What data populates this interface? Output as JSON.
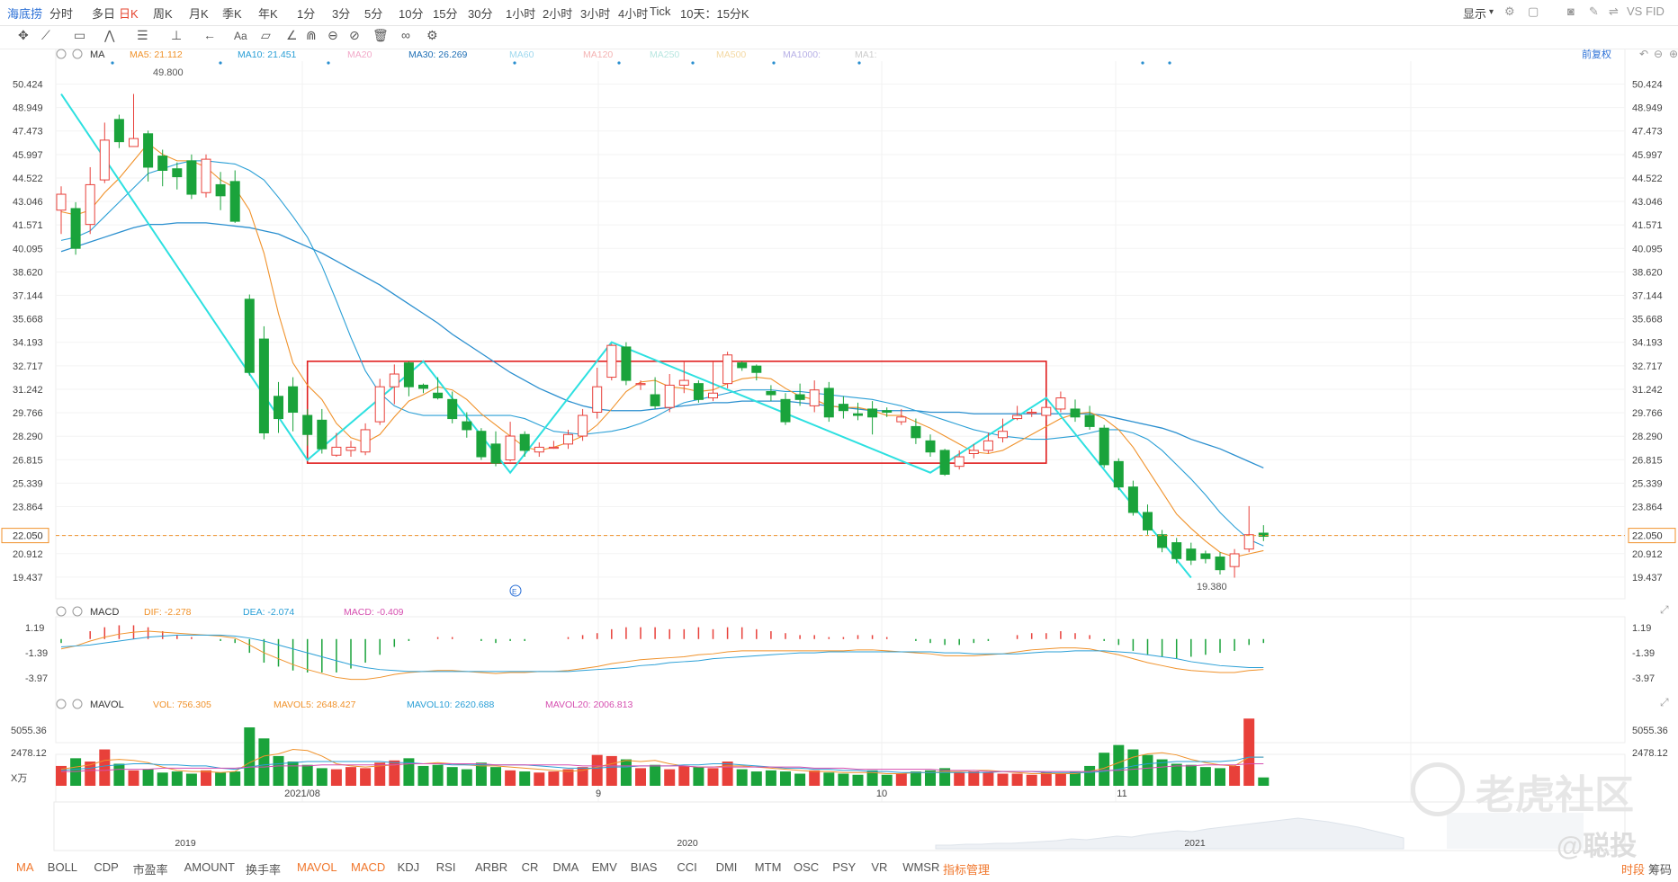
{
  "app": {
    "name": "海底捞"
  },
  "timeframes": [
    "分时",
    "多日",
    "日K",
    "周K",
    "月K",
    "季K",
    "年K",
    "1分",
    "3分",
    "5分",
    "10分",
    "15分",
    "30分",
    "1小时",
    "2小时",
    "3小时",
    "4小时",
    "Tick",
    "10天：15分K"
  ],
  "active_timeframe": "日K",
  "right_controls": {
    "display": "显示",
    "vs": "VS FID"
  },
  "price_legend": {
    "name": "MA",
    "items": [
      {
        "label": "MA5: 21.112",
        "color": "#f0922b"
      },
      {
        "label": "MA10: 21.451",
        "color": "#2a9fd6"
      },
      {
        "label": "MA20",
        "color": "#f2a9c9"
      },
      {
        "label": "MA30: 26.269",
        "color": "#1f6fb5"
      },
      {
        "label": "MA60",
        "color": "#9fd8ee"
      },
      {
        "label": "MA120",
        "color": "#f4b3b3"
      },
      {
        "label": "MA250",
        "color": "#b8e6e0"
      },
      {
        "label": "MA500",
        "color": "#f4d9a3"
      },
      {
        "label": "MA1000:",
        "color": "#b7b0e6"
      },
      {
        "label": "MA1:",
        "color": "#cccccc"
      }
    ],
    "adjust": "前复权"
  },
  "macd_legend": {
    "name": "MACD",
    "items": [
      {
        "label": "DIF: -2.278",
        "color": "#f0922b"
      },
      {
        "label": "DEA: -2.074",
        "color": "#2a9fd6"
      },
      {
        "label": "MACD: -0.409",
        "color": "#d64fb0"
      }
    ]
  },
  "vol_legend": {
    "name": "MAVOL",
    "items": [
      {
        "label": "VOL: 756.305",
        "color": "#f0922b"
      },
      {
        "label": "MAVOL5: 2648.427",
        "color": "#f0922b"
      },
      {
        "label": "MAVOL10: 2620.688",
        "color": "#2a9fd6"
      },
      {
        "label": "MAVOL20: 2006.813",
        "color": "#d64fb0"
      }
    ]
  },
  "annotations": {
    "high": "49.800",
    "low": "19.380",
    "current": "22.050",
    "event_marker": "E"
  },
  "x_labels": {
    "main": [
      "2021/08",
      "9",
      "10",
      "11"
    ],
    "overview": [
      "2019",
      "2020",
      "2021"
    ]
  },
  "indicators": [
    "MA",
    "BOLL",
    "CDP",
    "市盈率",
    "AMOUNT",
    "换手率",
    "MAVOL",
    "MACD",
    "KDJ",
    "RSI",
    "ARBR",
    "CR",
    "DMA",
    "EMV",
    "BIAS",
    "CCI",
    "DMI",
    "MTM",
    "OSC",
    "PSY",
    "VR",
    "WMSR"
  ],
  "active_indicators": [
    "MA",
    "MAVOL",
    "MACD"
  ],
  "indicator_manage": "指标管理",
  "right_tabs": [
    "时段",
    "筹码"
  ],
  "watermark": {
    "brand": "老虎社区",
    "user": "@聪投"
  },
  "chart_data": {
    "type": "candlestick",
    "y_ticks": [
      "50.424",
      "48.949",
      "47.473",
      "45.997",
      "44.522",
      "43.046",
      "41.571",
      "40.095",
      "38.620",
      "37.144",
      "35.668",
      "34.193",
      "32.717",
      "31.242",
      "29.766",
      "28.290",
      "26.815",
      "25.339",
      "23.864",
      "22.050",
      "20.912",
      "19.437"
    ],
    "ylim": [
      18.3,
      51.3
    ],
    "candles": [
      [
        42.5,
        43.5,
        41.0,
        44.0
      ],
      [
        42.6,
        40.1,
        39.7,
        43.0
      ],
      [
        41.6,
        44.1,
        41.0,
        45.2
      ],
      [
        44.4,
        46.9,
        44.2,
        48.0
      ],
      [
        48.2,
        46.8,
        46.4,
        48.5
      ],
      [
        46.5,
        47.0,
        46.5,
        49.8
      ],
      [
        47.3,
        45.2,
        44.3,
        47.5
      ],
      [
        45.9,
        45.0,
        44.0,
        46.3
      ],
      [
        45.1,
        44.6,
        43.8,
        45.5
      ],
      [
        45.6,
        43.5,
        43.2,
        46.0
      ],
      [
        43.6,
        45.7,
        43.3,
        46.0
      ],
      [
        44.1,
        43.4,
        42.5,
        44.9
      ],
      [
        44.3,
        41.8,
        41.7,
        45.0
      ],
      [
        36.9,
        32.3,
        32.1,
        37.2
      ],
      [
        34.4,
        28.5,
        28.1,
        35.2
      ],
      [
        30.8,
        29.4,
        28.5,
        31.7
      ],
      [
        31.4,
        29.8,
        28.6,
        32.0
      ],
      [
        29.6,
        28.4,
        27.7,
        30.0
      ],
      [
        29.3,
        27.5,
        27.2,
        30.0
      ],
      [
        27.1,
        27.6,
        27.0,
        28.5
      ],
      [
        27.4,
        27.6,
        27.0,
        28.0
      ],
      [
        27.3,
        28.7,
        27.1,
        29.1
      ],
      [
        29.2,
        31.4,
        29.0,
        31.9
      ],
      [
        31.4,
        32.2,
        30.3,
        32.8
      ],
      [
        32.9,
        31.4,
        30.8,
        33.0
      ],
      [
        31.5,
        31.3,
        31.0,
        31.6
      ],
      [
        31.0,
        30.7,
        30.6,
        32.0
      ],
      [
        30.6,
        29.4,
        29.1,
        31.1
      ],
      [
        29.2,
        28.7,
        28.2,
        29.8
      ],
      [
        28.6,
        27.0,
        26.8,
        28.8
      ],
      [
        27.8,
        26.6,
        26.4,
        28.6
      ],
      [
        26.8,
        28.3,
        26.7,
        29.2
      ],
      [
        28.4,
        27.4,
        27.0,
        28.6
      ],
      [
        27.3,
        27.6,
        27.0,
        27.9
      ],
      [
        27.6,
        27.6,
        27.5,
        28.0
      ],
      [
        27.8,
        28.4,
        27.5,
        28.7
      ],
      [
        28.3,
        29.6,
        28.0,
        30.0
      ],
      [
        29.8,
        31.4,
        29.4,
        32.6
      ],
      [
        32.0,
        34.0,
        31.8,
        34.1
      ],
      [
        33.9,
        31.8,
        31.5,
        34.2
      ],
      [
        31.6,
        31.6,
        31.2,
        31.8
      ],
      [
        30.9,
        30.2,
        30.0,
        32.0
      ],
      [
        30.1,
        31.5,
        29.8,
        32.2
      ],
      [
        31.5,
        31.8,
        31.0,
        33.0
      ],
      [
        31.6,
        30.6,
        30.4,
        31.8
      ],
      [
        30.7,
        31.0,
        30.5,
        33.0
      ],
      [
        31.6,
        33.4,
        31.3,
        33.6
      ],
      [
        32.9,
        32.6,
        32.4,
        33.0
      ],
      [
        32.7,
        32.3,
        31.8,
        32.8
      ],
      [
        31.1,
        30.9,
        30.5,
        31.5
      ],
      [
        30.6,
        29.2,
        29.0,
        31.0
      ],
      [
        30.9,
        30.6,
        30.2,
        31.6
      ],
      [
        30.2,
        31.2,
        29.8,
        31.8
      ],
      [
        31.3,
        29.5,
        29.2,
        31.7
      ],
      [
        30.3,
        29.9,
        29.4,
        30.8
      ],
      [
        29.7,
        29.6,
        29.3,
        30.4
      ],
      [
        30.0,
        29.5,
        28.4,
        30.5
      ],
      [
        29.9,
        29.8,
        29.5,
        30.1
      ],
      [
        29.2,
        29.5,
        29.0,
        30.0
      ],
      [
        28.9,
        28.2,
        27.8,
        29.4
      ],
      [
        28.0,
        27.3,
        27.0,
        28.4
      ],
      [
        27.4,
        25.9,
        25.8,
        27.5
      ],
      [
        26.4,
        27.0,
        26.2,
        27.4
      ],
      [
        27.2,
        27.4,
        26.9,
        27.8
      ],
      [
        27.4,
        28.0,
        27.2,
        28.5
      ],
      [
        28.2,
        28.6,
        27.9,
        29.4
      ],
      [
        29.4,
        29.6,
        29.3,
        30.2
      ],
      [
        29.8,
        29.8,
        29.5,
        30.0
      ],
      [
        29.6,
        30.1,
        29.3,
        30.3
      ],
      [
        30.0,
        30.7,
        29.8,
        31.1
      ],
      [
        30.0,
        29.5,
        29.2,
        30.6
      ],
      [
        29.6,
        28.9,
        28.7,
        30.2
      ],
      [
        28.8,
        26.5,
        26.3,
        29.0
      ],
      [
        26.7,
        25.1,
        24.9,
        26.9
      ],
      [
        25.1,
        23.5,
        23.3,
        25.5
      ],
      [
        23.5,
        22.4,
        22.1,
        24.0
      ],
      [
        22.1,
        21.3,
        21.0,
        22.4
      ],
      [
        21.6,
        20.6,
        20.3,
        21.9
      ],
      [
        21.2,
        20.5,
        20.2,
        21.6
      ],
      [
        20.9,
        20.6,
        20.3,
        21.1
      ],
      [
        20.7,
        19.9,
        19.6,
        21.0
      ],
      [
        20.1,
        20.9,
        19.4,
        21.2
      ],
      [
        21.2,
        22.1,
        21.0,
        23.9
      ],
      [
        22.2,
        22.0,
        21.7,
        22.7
      ]
    ],
    "ma5": [
      42.4,
      42.2,
      42.5,
      43.6,
      44.5,
      45.6,
      46.7,
      46.0,
      45.6,
      45.6,
      45.2,
      44.4,
      43.9,
      42.5,
      39.8,
      36.0,
      32.9,
      31.5,
      30.6,
      29.1,
      28.2,
      27.9,
      28.4,
      29.5,
      30.5,
      30.9,
      31.4,
      31.2,
      30.6,
      29.7,
      29.0,
      28.3,
      27.6,
      27.4,
      27.6,
      27.9,
      28.3,
      29.0,
      30.0,
      31.1,
      31.7,
      31.8,
      31.4,
      31.3,
      31.1,
      31.2,
      31.6,
      31.9,
      32.0,
      31.9,
      31.3,
      30.8,
      30.6,
      30.2,
      30.1,
      30.1,
      29.9,
      29.6,
      29.6,
      29.2,
      28.8,
      28.3,
      27.8,
      27.3,
      27.2,
      27.4,
      27.9,
      28.4,
      28.9,
      29.4,
      29.7,
      29.8,
      29.4,
      28.7,
      27.6,
      26.2,
      24.8,
      23.4,
      22.5,
      21.7,
      21.0,
      20.7,
      20.9,
      21.1
    ],
    "ma10": [
      40.6,
      40.8,
      41.2,
      42.1,
      43.0,
      43.9,
      44.8,
      45.1,
      45.4,
      45.6,
      45.6,
      45.5,
      45.4,
      45.0,
      44.4,
      43.3,
      42.1,
      40.8,
      39.0,
      36.8,
      34.5,
      32.4,
      31.0,
      30.2,
      29.8,
      29.6,
      29.6,
      29.6,
      29.6,
      29.6,
      29.6,
      29.6,
      29.4,
      29.0,
      28.6,
      28.5,
      28.4,
      28.5,
      28.6,
      28.8,
      29.1,
      29.5,
      30.0,
      30.4,
      30.6,
      30.8,
      31.0,
      31.2,
      31.2,
      31.2,
      31.1,
      31.1,
      31.0,
      30.9,
      30.8,
      30.7,
      30.6,
      30.4,
      30.2,
      29.9,
      29.6,
      29.3,
      29.0,
      28.7,
      28.5,
      28.3,
      28.2,
      28.1,
      28.1,
      28.2,
      28.3,
      28.5,
      28.7,
      28.7,
      28.5,
      28.1,
      27.4,
      26.5,
      25.6,
      24.6,
      23.5,
      22.6,
      21.8,
      21.4
    ],
    "ma30": [
      39.9,
      40.2,
      40.5,
      40.8,
      41.1,
      41.4,
      41.6,
      41.6,
      41.7,
      41.7,
      41.7,
      41.6,
      41.5,
      41.4,
      41.2,
      41.0,
      40.6,
      40.2,
      39.8,
      39.3,
      38.8,
      38.3,
      37.8,
      37.2,
      36.6,
      36.0,
      35.4,
      34.7,
      34.1,
      33.5,
      32.9,
      32.3,
      31.8,
      31.3,
      30.9,
      30.5,
      30.2,
      30.0,
      29.9,
      29.9,
      29.9,
      30.0,
      30.1,
      30.2,
      30.3,
      30.4,
      30.4,
      30.5,
      30.5,
      30.5,
      30.5,
      30.4,
      30.3,
      30.2,
      30.1,
      30.0,
      29.9,
      29.9,
      29.9,
      29.9,
      29.8,
      29.8,
      29.8,
      29.7,
      29.7,
      29.7,
      29.7,
      29.7,
      29.7,
      29.7,
      29.7,
      29.7,
      29.6,
      29.4,
      29.2,
      29.0,
      28.8,
      28.5,
      28.1,
      27.8,
      27.5,
      27.1,
      26.7,
      26.3
    ],
    "zigzag": [
      [
        0,
        49.8
      ],
      [
        17,
        26.8
      ],
      [
        25,
        33.0
      ],
      [
        31,
        26.0
      ],
      [
        38,
        34.2
      ],
      [
        60,
        26.0
      ],
      [
        68,
        30.7
      ],
      [
        78,
        19.4
      ]
    ],
    "box": {
      "x0": 17,
      "x1": 68,
      "y_top": 33.0,
      "y_bottom": 26.6
    },
    "current_price": 22.05,
    "macd_ticks": [
      "1.19",
      "-1.39",
      "-3.97"
    ],
    "macd_ylim": [
      -4.5,
      1.9
    ],
    "dif": [
      -1.0,
      -0.7,
      -0.2,
      0.2,
      0.5,
      0.7,
      0.8,
      0.7,
      0.6,
      0.5,
      0.4,
      0.3,
      0.1,
      -0.6,
      -1.4,
      -2.0,
      -2.6,
      -3.1,
      -3.5,
      -3.9,
      -4.1,
      -4.1,
      -3.9,
      -3.6,
      -3.4,
      -3.3,
      -3.2,
      -3.2,
      -3.3,
      -3.4,
      -3.5,
      -3.4,
      -3.4,
      -3.3,
      -3.3,
      -3.2,
      -3.0,
      -2.8,
      -2.5,
      -2.3,
      -2.1,
      -2.0,
      -1.9,
      -1.8,
      -1.6,
      -1.5,
      -1.3,
      -1.2,
      -1.2,
      -1.2,
      -1.2,
      -1.2,
      -1.2,
      -1.2,
      -1.2,
      -1.1,
      -1.1,
      -1.2,
      -1.3,
      -1.4,
      -1.5,
      -1.7,
      -1.7,
      -1.7,
      -1.6,
      -1.5,
      -1.3,
      -1.1,
      -1.0,
      -0.9,
      -0.9,
      -1.0,
      -1.3,
      -1.6,
      -2.0,
      -2.4,
      -2.7,
      -3.0,
      -3.2,
      -3.3,
      -3.4,
      -3.4,
      -3.2,
      -3.1
    ],
    "dea": [
      -0.8,
      -0.7,
      -0.6,
      -0.4,
      -0.2,
      0.0,
      0.2,
      0.3,
      0.4,
      0.4,
      0.4,
      0.4,
      0.3,
      0.1,
      -0.2,
      -0.6,
      -1.0,
      -1.4,
      -1.8,
      -2.2,
      -2.6,
      -2.9,
      -3.1,
      -3.2,
      -3.3,
      -3.3,
      -3.3,
      -3.3,
      -3.3,
      -3.3,
      -3.3,
      -3.3,
      -3.3,
      -3.3,
      -3.3,
      -3.3,
      -3.2,
      -3.1,
      -3.0,
      -2.9,
      -2.7,
      -2.6,
      -2.4,
      -2.3,
      -2.2,
      -2.0,
      -1.9,
      -1.8,
      -1.7,
      -1.6,
      -1.5,
      -1.4,
      -1.4,
      -1.3,
      -1.3,
      -1.3,
      -1.3,
      -1.3,
      -1.3,
      -1.3,
      -1.3,
      -1.4,
      -1.4,
      -1.5,
      -1.5,
      -1.5,
      -1.5,
      -1.4,
      -1.3,
      -1.3,
      -1.2,
      -1.2,
      -1.2,
      -1.3,
      -1.4,
      -1.6,
      -1.8,
      -2.0,
      -2.3,
      -2.5,
      -2.7,
      -2.8,
      -2.9,
      -2.9
    ],
    "vol_ticks": [
      "5055.36",
      "2478.12",
      "X万"
    ],
    "vol_max": 6200,
    "volumes": [
      1800,
      2500,
      2200,
      3300,
      2000,
      1400,
      1500,
      1200,
      1300,
      1100,
      1400,
      1200,
      1300,
      5300,
      4300,
      2700,
      2200,
      1900,
      1600,
      1500,
      1700,
      1600,
      2100,
      2300,
      2500,
      1800,
      1900,
      1700,
      1500,
      2100,
      1700,
      1400,
      1300,
      1200,
      1300,
      1500,
      1700,
      2800,
      2700,
      2400,
      1600,
      1900,
      1500,
      1800,
      1700,
      1600,
      2200,
      1500,
      1300,
      1400,
      1300,
      1100,
      1400,
      1200,
      1100,
      1000,
      1400,
      1000,
      1100,
      1300,
      1400,
      1600,
      1200,
      1300,
      1200,
      1100,
      1100,
      1000,
      1200,
      1100,
      1300,
      1800,
      3000,
      3700,
      3300,
      2800,
      2400,
      2000,
      1900,
      1700,
      1600,
      1800,
      6100,
      760
    ],
    "mavol5": [
      1500,
      1700,
      1900,
      2300,
      2400,
      2300,
      2100,
      1700,
      1400,
      1300,
      1300,
      1200,
      1300,
      2100,
      2700,
      2900,
      3300,
      3200,
      2700,
      2000,
      1800,
      1700,
      1800,
      1900,
      2000,
      2000,
      2100,
      2000,
      1900,
      1800,
      1800,
      1700,
      1600,
      1500,
      1400,
      1300,
      1400,
      1700,
      2000,
      2300,
      2200,
      2300,
      2000,
      1800,
      1700,
      1700,
      1800,
      1800,
      1700,
      1600,
      1500,
      1400,
      1300,
      1300,
      1200,
      1200,
      1200,
      1100,
      1100,
      1200,
      1200,
      1300,
      1300,
      1400,
      1400,
      1300,
      1200,
      1100,
      1100,
      1100,
      1100,
      1300,
      1600,
      2100,
      2600,
      2900,
      3000,
      2800,
      2400,
      2100,
      1900,
      1800,
      2600,
      2600
    ],
    "mavol10": [
      1400,
      1500,
      1600,
      1800,
      1900,
      2000,
      2000,
      1900,
      1900,
      1800,
      1800,
      1600,
      1500,
      1700,
      1900,
      2000,
      2100,
      2200,
      2200,
      2200,
      2200,
      2200,
      2200,
      2100,
      2100,
      2000,
      2000,
      1900,
      1900,
      1900,
      1900,
      1900,
      1900,
      1800,
      1700,
      1600,
      1600,
      1600,
      1700,
      1700,
      1800,
      1800,
      1800,
      1900,
      1900,
      2000,
      2000,
      1900,
      1800,
      1700,
      1600,
      1600,
      1500,
      1500,
      1400,
      1400,
      1300,
      1300,
      1200,
      1200,
      1200,
      1200,
      1200,
      1200,
      1200,
      1300,
      1300,
      1300,
      1200,
      1200,
      1200,
      1200,
      1300,
      1500,
      1800,
      2000,
      2100,
      2200,
      2200,
      2200,
      2200,
      2300,
      2600,
      2600
    ],
    "mavol20": [
      1300,
      1300,
      1400,
      1400,
      1500,
      1500,
      1500,
      1600,
      1600,
      1600,
      1600,
      1600,
      1600,
      1700,
      1700,
      1800,
      1800,
      1800,
      1900,
      1900,
      1900,
      1900,
      1900,
      1900,
      2000,
      2000,
      2000,
      2000,
      2000,
      2000,
      1900,
      1900,
      1900,
      1900,
      1900,
      1900,
      1800,
      1800,
      1800,
      1800,
      1800,
      1800,
      1800,
      1800,
      1700,
      1700,
      1700,
      1700,
      1700,
      1700,
      1700,
      1700,
      1600,
      1600,
      1600,
      1500,
      1500,
      1500,
      1500,
      1500,
      1500,
      1400,
      1400,
      1400,
      1300,
      1300,
      1300,
      1300,
      1300,
      1300,
      1300,
      1300,
      1400,
      1400,
      1500,
      1600,
      1700,
      1800,
      1800,
      1900,
      1900,
      1900,
      2000,
      2000
    ],
    "overview": [
      2,
      2,
      3,
      3,
      4,
      4,
      5,
      6,
      7,
      9,
      8,
      10,
      12,
      11,
      14,
      16,
      18,
      17,
      20,
      22,
      24,
      26,
      28,
      30,
      32,
      30,
      28,
      25,
      22,
      18,
      14,
      10
    ]
  }
}
